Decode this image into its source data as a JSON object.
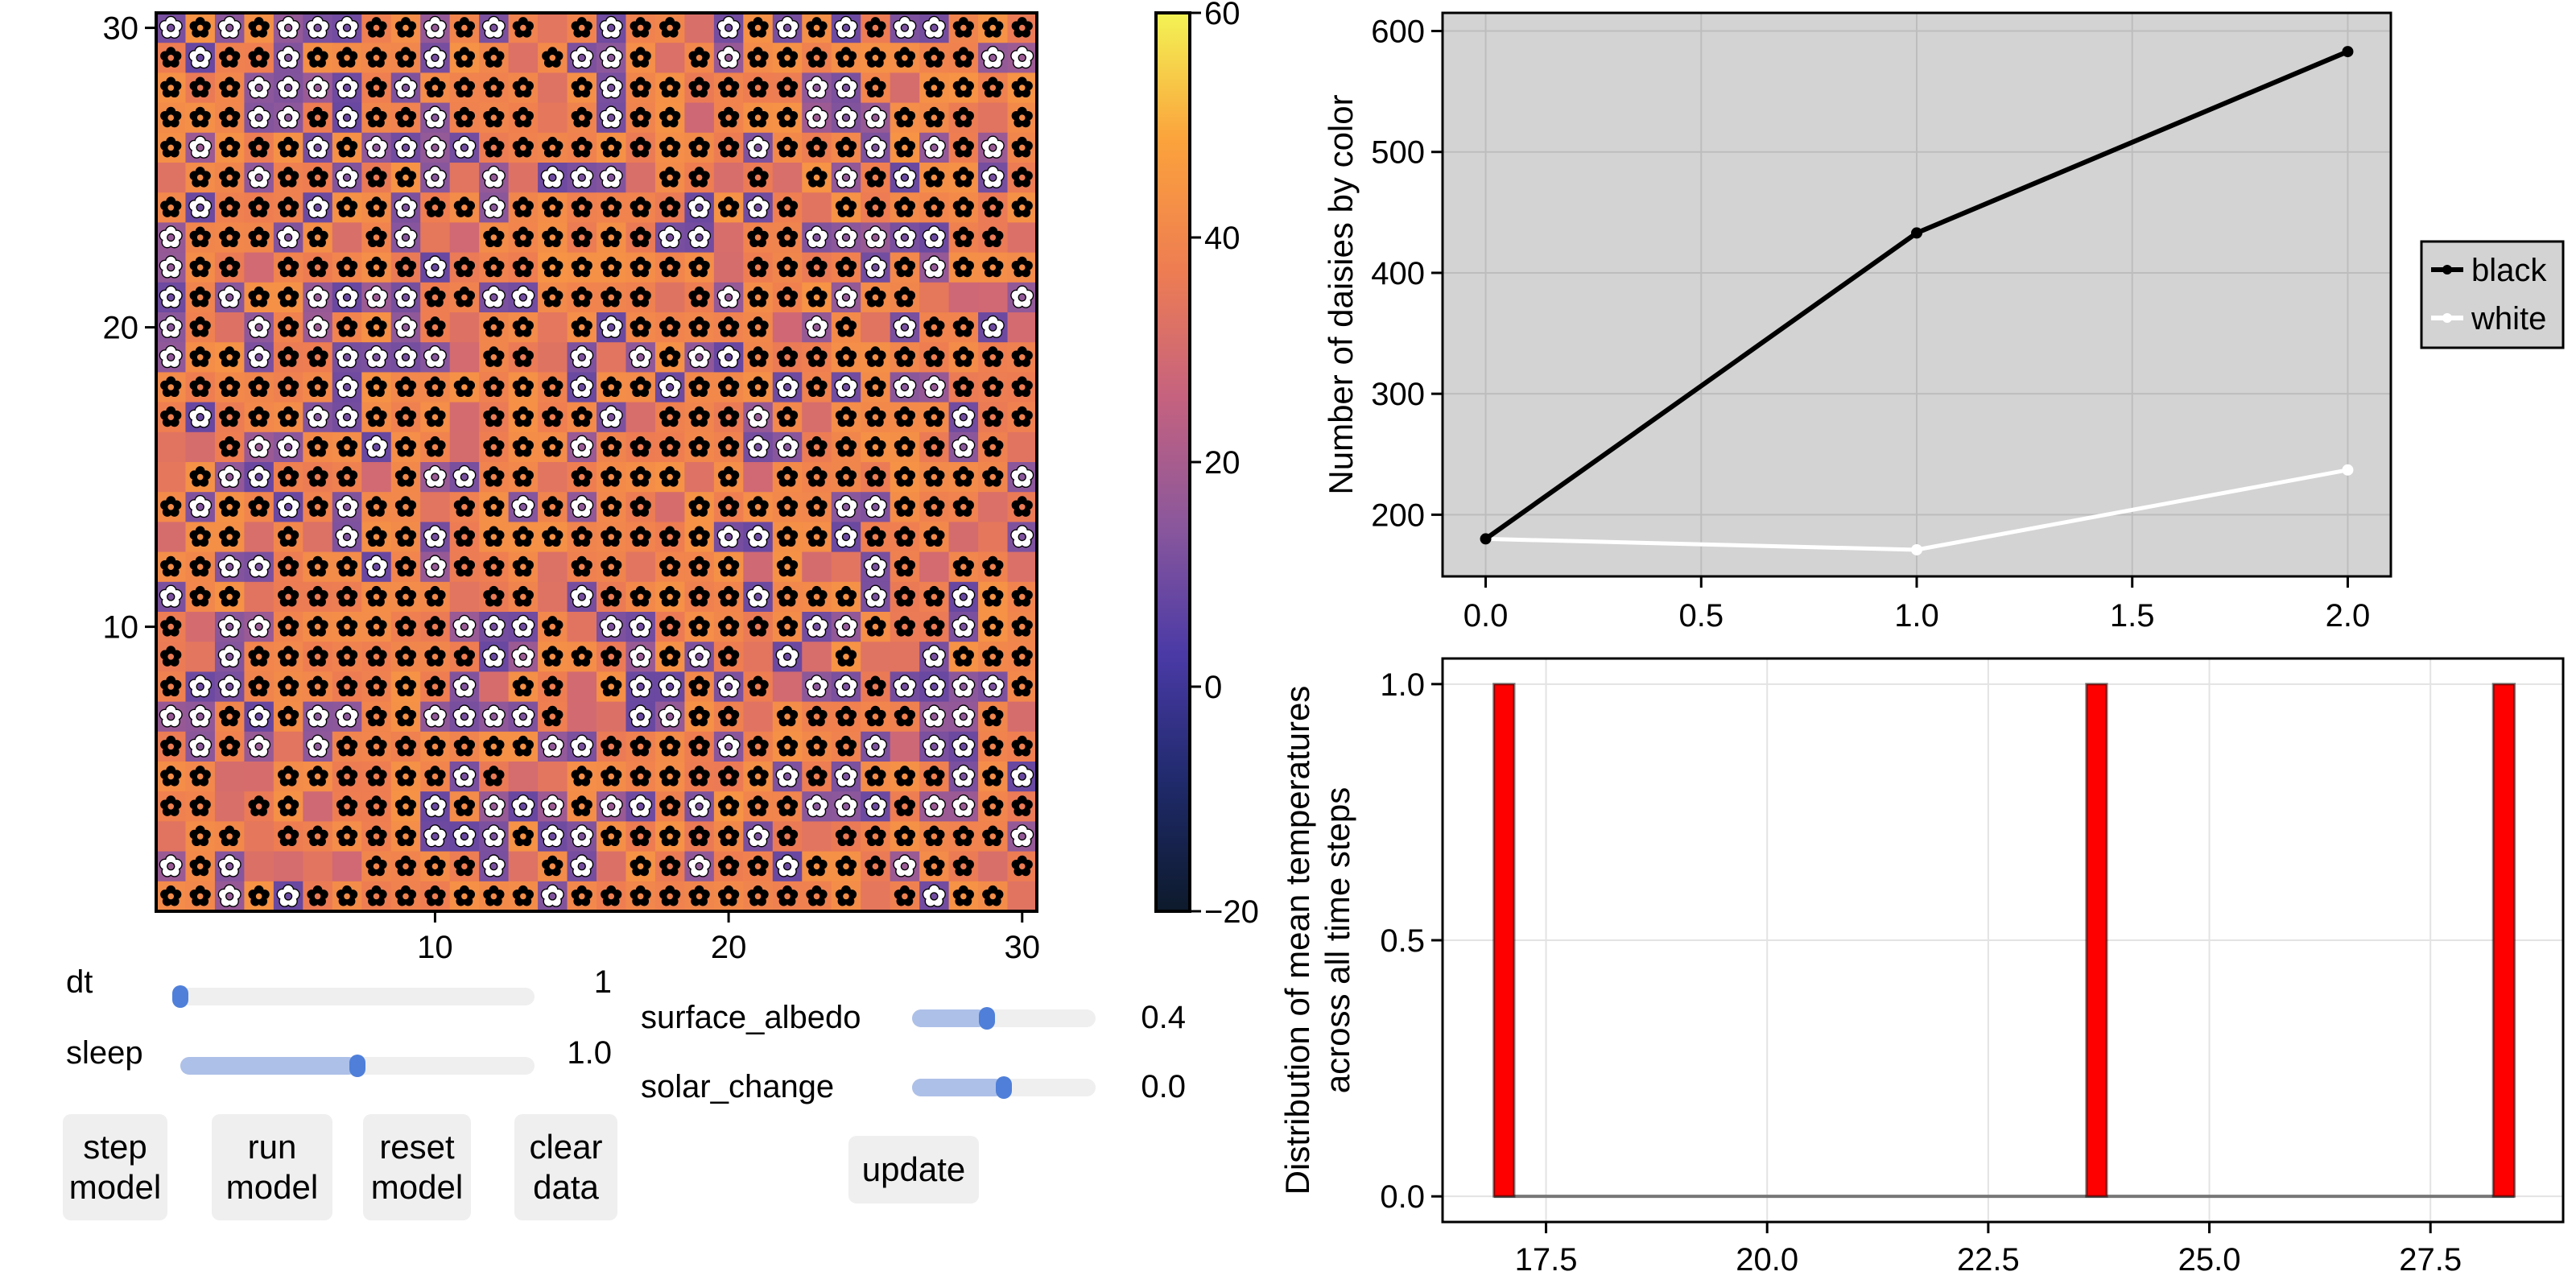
{
  "heatmap": {
    "xticks": [
      "10",
      "20",
      "30"
    ],
    "yticks": [
      "10",
      "20",
      "30"
    ],
    "grid_size": 30,
    "colorbar": {
      "ticks": [
        "60",
        "40",
        "20",
        "0",
        "−20"
      ],
      "range": [
        -20,
        60
      ]
    },
    "colormap": [
      "#0d1a2b",
      "#1f2a6b",
      "#4a3aa6",
      "#8a579c",
      "#c5627f",
      "#ee7d52",
      "#fba23c",
      "#f3f354"
    ],
    "agent_icons": {
      "black": "black-daisy-icon",
      "white": "white-daisy-icon"
    }
  },
  "controls": {
    "sliders": [
      {
        "label": "dt",
        "value": "1",
        "level": 0.0
      },
      {
        "label": "sleep",
        "value": "1.0",
        "level": 0.5
      },
      {
        "label": "surface_albedo",
        "value": "0.4",
        "level": 0.41
      },
      {
        "label": "solar_change",
        "value": "0.0",
        "level": 0.5
      }
    ],
    "buttons": {
      "step": [
        "step",
        "model"
      ],
      "run": [
        "run",
        "model"
      ],
      "reset": [
        "reset",
        "model"
      ],
      "clear": [
        "clear",
        "data"
      ],
      "update": "update"
    }
  },
  "chart_data": [
    {
      "type": "line",
      "ylabel": "Number of daisies by color",
      "xlabel": "",
      "xlim": [
        -0.1,
        2.1
      ],
      "ylim": [
        149,
        615
      ],
      "xticks": [
        "0.0",
        "0.5",
        "1.0",
        "1.5",
        "2.0"
      ],
      "yticks": [
        "200",
        "300",
        "400",
        "500",
        "600"
      ],
      "grid": true,
      "background": "#d3d3d3",
      "legend": {
        "placement": "right",
        "entries": [
          "black",
          "white"
        ]
      },
      "x": [
        0,
        1,
        2
      ],
      "series": [
        {
          "name": "black",
          "color": "#000000",
          "values": [
            180,
            433,
            583
          ]
        },
        {
          "name": "white",
          "color": "#ffffff",
          "values": [
            180,
            171,
            237
          ]
        }
      ]
    },
    {
      "type": "bar",
      "ylabel": [
        "Distribution of mean temperatures",
        "across all time steps"
      ],
      "xlabel": "",
      "xlim": [
        16.33,
        29.0
      ],
      "ylim": [
        -0.05,
        1.05
      ],
      "xticks": [
        "17.5",
        "20.0",
        "22.5",
        "25.0",
        "27.5"
      ],
      "yticks": [
        "0.0",
        "0.5",
        "1.0"
      ],
      "grid": true,
      "bar_color": "#ff0000",
      "bars": [
        {
          "x0": 16.91,
          "x1": 17.14,
          "count": 1
        },
        {
          "x0": 23.61,
          "x1": 23.84,
          "count": 1
        },
        {
          "x0": 28.21,
          "x1": 28.45,
          "count": 1
        }
      ]
    }
  ]
}
